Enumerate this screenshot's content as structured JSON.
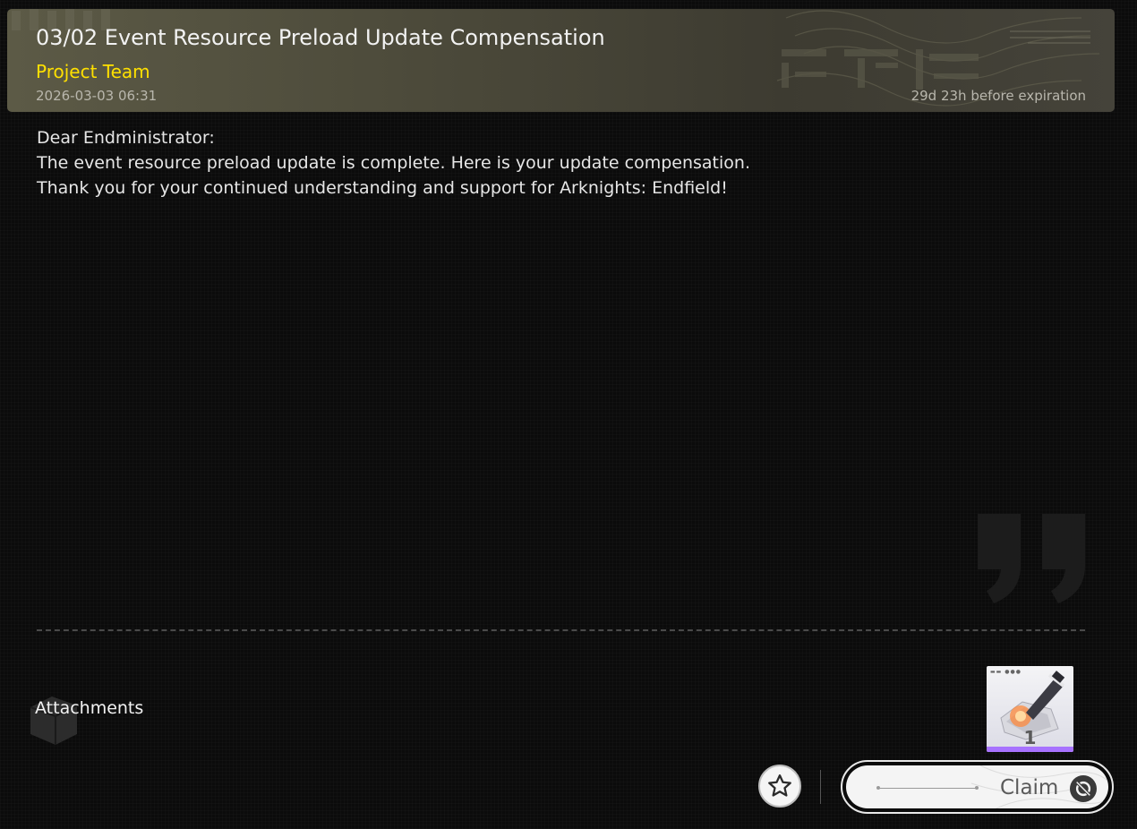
{
  "mail": {
    "title": "03/02 Event Resource Preload Update Compensation",
    "sender": "Project Team",
    "date": "2026-03-03 06:31",
    "expiry": "29d 23h before expiration",
    "body_lines": [
      "Dear Endministrator:",
      "The event resource preload update is complete. Here is your update compensation.",
      "Thank you for your continued understanding and support for Arknights: Endfield!"
    ]
  },
  "attachments": {
    "label": "Attachments",
    "items": [
      {
        "quantity": "1",
        "rarity_color": "#a772ff",
        "icon": "item-icon"
      }
    ]
  },
  "actions": {
    "favorite_icon": "star-icon",
    "claim_label": "Claim",
    "claim_icon": "refresh-icon"
  },
  "colors": {
    "sender": "#ffe000",
    "accent_rarity": "#a772ff",
    "header_bg": "#4d4b3b"
  }
}
